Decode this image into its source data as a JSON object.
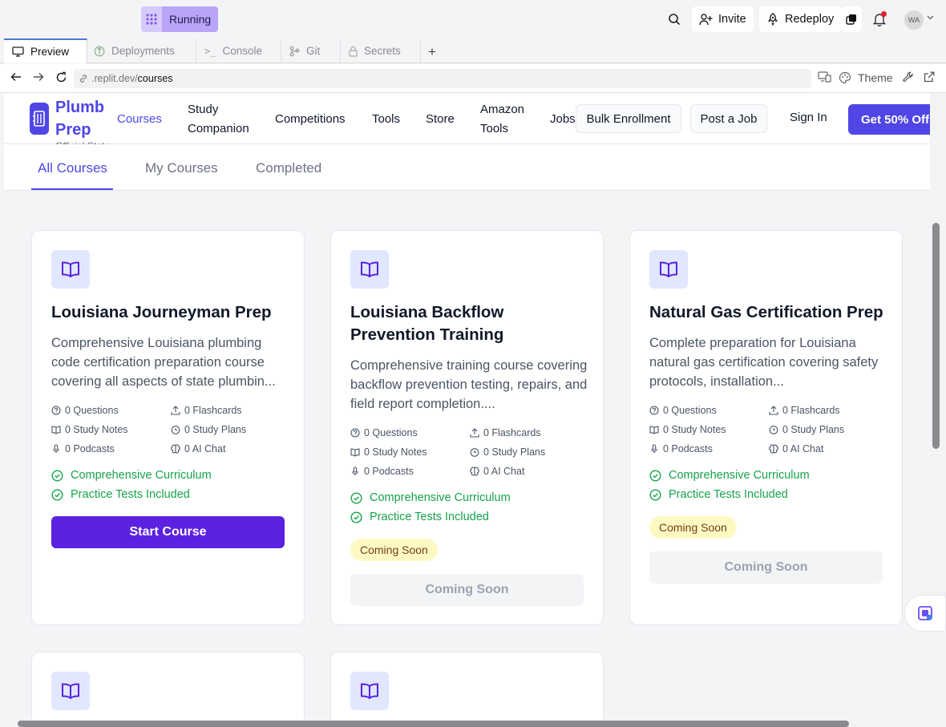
{
  "replit": {
    "status_label": "Running",
    "invite_label": "Invite",
    "redeploy_label": "Redeploy",
    "avatar_initials": "WA",
    "tabs": [
      {
        "label": "Preview"
      },
      {
        "label": "Deployments"
      },
      {
        "label": "Console"
      },
      {
        "label": "Git"
      },
      {
        "label": "Secrets"
      }
    ],
    "add_tab_label": "+",
    "url_prefix": ".replit.dev/",
    "url_path": "courses",
    "theme_label": "Theme"
  },
  "site": {
    "brand_name": "Plumb Prep",
    "brand_tagline": "Official State Prep Course",
    "nav": [
      {
        "label": "Courses"
      },
      {
        "label": "Study Companion"
      },
      {
        "label": "Competitions"
      },
      {
        "label": "Tools"
      },
      {
        "label": "Store"
      },
      {
        "label": "Amazon Tools"
      },
      {
        "label": "Jobs"
      }
    ],
    "bulk_label": "Bulk Enrollment",
    "post_job_label": "Post a Job",
    "signin_label": "Sign In",
    "cta_label": "Get 50% Off",
    "subtabs": [
      {
        "label": "All Courses"
      },
      {
        "label": "My Courses"
      },
      {
        "label": "Completed"
      }
    ]
  },
  "courses": [
    {
      "title": "Louisiana Journeyman Prep",
      "description": "Comprehensive Louisiana plumbing code certification preparation course covering all aspects of state plumbin...",
      "stats": [
        "0 Questions",
        "0 Flashcards",
        "0 Study Notes",
        "0 Study Plans",
        "0 Podcasts",
        "0 AI Chat"
      ],
      "features": [
        "Comprehensive Curriculum",
        "Practice Tests Included"
      ],
      "button_label": "Start Course"
    },
    {
      "title": "Louisiana Backflow Prevention Training",
      "description": "Comprehensive training course covering backflow prevention testing, repairs, and field report completion....",
      "stats": [
        "0 Questions",
        "0 Flashcards",
        "0 Study Notes",
        "0 Study Plans",
        "0 Podcasts",
        "0 AI Chat"
      ],
      "features": [
        "Comprehensive Curriculum",
        "Practice Tests Included"
      ],
      "badge_label": "Coming Soon",
      "button_label": "Coming Soon"
    },
    {
      "title": "Natural Gas Certification Prep",
      "description": "Complete preparation for Louisiana natural gas certification covering safety protocols, installation...",
      "stats": [
        "0 Questions",
        "0 Flashcards",
        "0 Study Notes",
        "0 Study Plans",
        "0 Podcasts",
        "0 AI Chat"
      ],
      "features": [
        "Comprehensive Curriculum",
        "Practice Tests Included"
      ],
      "badge_label": "Coming Soon",
      "button_label": "Coming Soon"
    }
  ],
  "colors": {
    "brand": "#4f46e5",
    "start_button": "#5b21e0",
    "feature_green": "#16a34a",
    "badge_bg": "#fef9c3"
  },
  "icons": [
    "search-icon",
    "person-add-icon",
    "rocket-icon",
    "copy-icon",
    "bell-icon",
    "book-open-icon",
    "help-circle-icon",
    "upload-icon",
    "timer-icon",
    "mic-icon",
    "brain-icon",
    "check-circle-icon"
  ]
}
